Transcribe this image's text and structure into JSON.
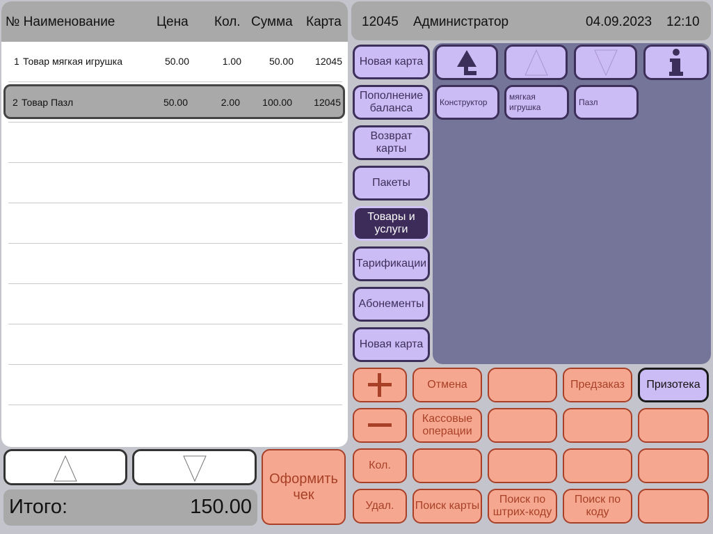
{
  "receipt": {
    "columns": {
      "number_name": "№ Наименование",
      "price": "Цена",
      "qty": "Кол.",
      "sum": "Сумма",
      "card": "Карта"
    },
    "rows": [
      {
        "num": "1",
        "name": "Товар мягкая игрушка",
        "price": "50.00",
        "qty": "1.00",
        "sum": "50.00",
        "card": "12045"
      },
      {
        "num": "2",
        "name": "Товар Пазл",
        "price": "50.00",
        "qty": "2.00",
        "sum": "100.00",
        "card": "12045"
      }
    ],
    "total_label": "Итого:",
    "total_value": "150.00"
  },
  "header": {
    "card_number": "12045",
    "user": "Администратор",
    "date": "04.09.2023",
    "time": "12:10"
  },
  "categories": [
    {
      "label": "Новая карта"
    },
    {
      "label": "Пополнение баланса"
    },
    {
      "label": "Возврат карты"
    },
    {
      "label": "Пакеты"
    },
    {
      "label": "Товары и услуги",
      "active": true
    },
    {
      "label": "Тарификации"
    },
    {
      "label": "Абонементы"
    },
    {
      "label": "Новая карта"
    }
  ],
  "goods_nav": {
    "icons": [
      "tree-up-icon",
      "arrow-up-icon",
      "arrow-down-icon",
      "info-icon"
    ]
  },
  "goods": [
    {
      "label": "Конструктор"
    },
    {
      "label": "мягкая игрушка"
    },
    {
      "label": "Пазл"
    }
  ],
  "operations": {
    "plus_icon": "plus-icon",
    "minus_icon": "minus-icon",
    "cancel": "Отмена",
    "preorder": "Предзаказ",
    "prize_library": "Призотека",
    "cash_operations": "Кассовые операции",
    "qty": "Кол.",
    "delete": "Удал.",
    "search_card": "Поиск карты",
    "search_barcode": "Поиск по штрих-коду",
    "search_code": "Поиск по коду",
    "checkout": "Оформить чек"
  },
  "colors": {
    "header_gray": "#a9a9a9",
    "purple_button": "#ccbcf5",
    "purple_active": "#3d2b5a",
    "goods_panel": "#757599",
    "salmon_button": "#f5a88f",
    "salmon_border": "#a84028"
  }
}
